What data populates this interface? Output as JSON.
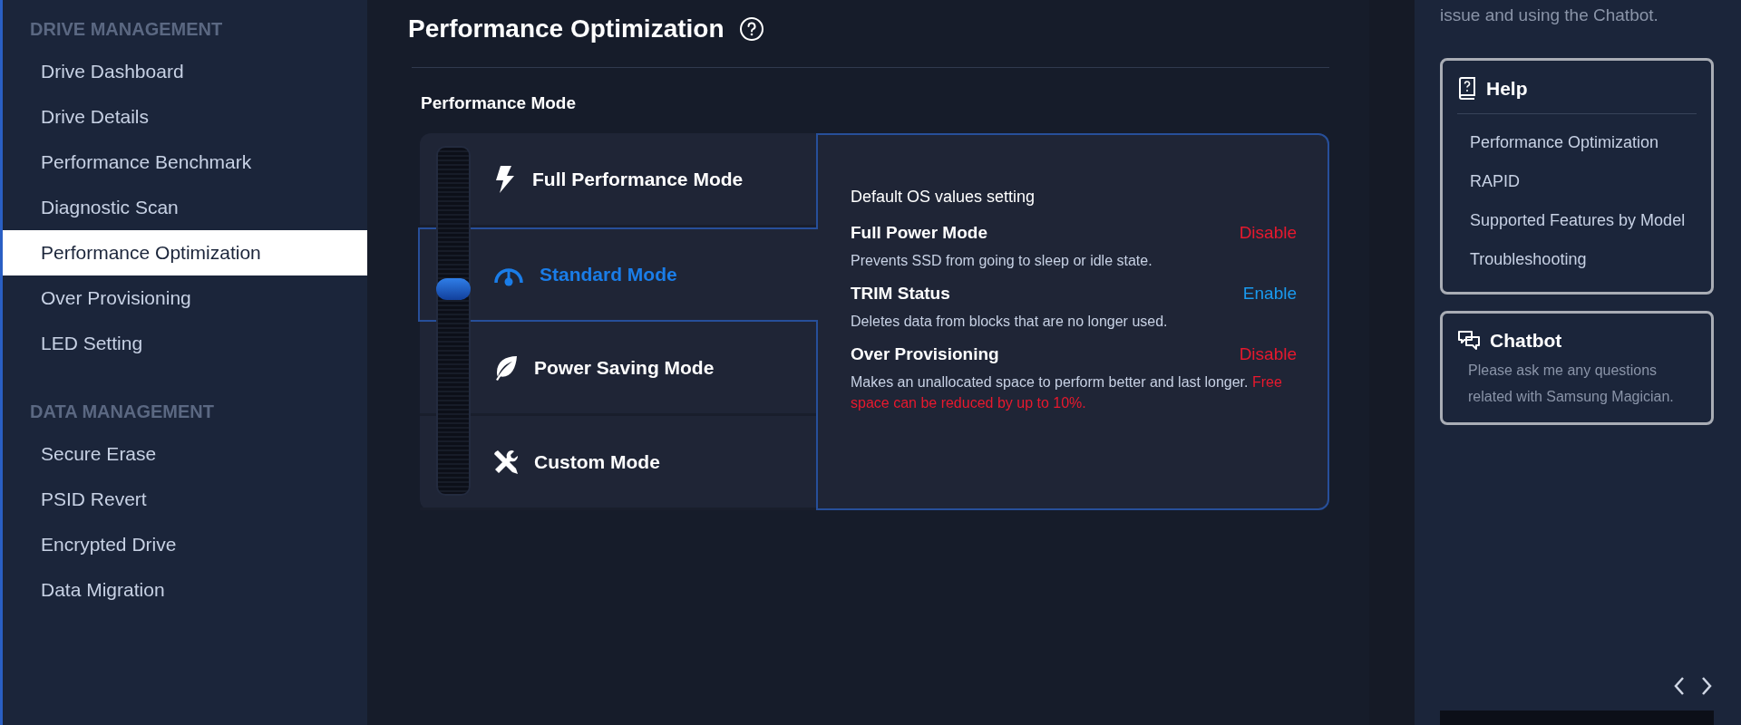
{
  "sidebar": {
    "sections": [
      {
        "heading": "DRIVE MANAGEMENT",
        "items": [
          {
            "label": "Drive Dashboard",
            "selected": false
          },
          {
            "label": "Drive Details",
            "selected": false
          },
          {
            "label": "Performance Benchmark",
            "selected": false
          },
          {
            "label": "Diagnostic Scan",
            "selected": false
          },
          {
            "label": "Performance Optimization",
            "selected": true
          },
          {
            "label": "Over Provisioning",
            "selected": false
          },
          {
            "label": "LED Setting",
            "selected": false
          }
        ]
      },
      {
        "heading": "DATA MANAGEMENT",
        "items": [
          {
            "label": "Secure Erase",
            "selected": false
          },
          {
            "label": "PSID Revert",
            "selected": false
          },
          {
            "label": "Encrypted Drive",
            "selected": false
          },
          {
            "label": "Data Migration",
            "selected": false
          }
        ]
      }
    ]
  },
  "main": {
    "title": "Performance Optimization",
    "section_title": "Performance Mode",
    "modes": [
      {
        "label": "Full Performance Mode",
        "kind": "bolt",
        "selected": false
      },
      {
        "label": "Standard Mode",
        "kind": "gauge",
        "selected": true
      },
      {
        "label": "Power Saving Mode",
        "kind": "leaf",
        "selected": false
      },
      {
        "label": "Custom Mode",
        "kind": "tools",
        "selected": false
      }
    ],
    "details": {
      "heading": "Default OS values setting",
      "settings": [
        {
          "name": "Full Power Mode",
          "status": "Disable",
          "enabled": false,
          "description": "Prevents SSD from going to sleep or idle state."
        },
        {
          "name": "TRIM Status",
          "status": "Enable",
          "enabled": true,
          "description": "Deletes data from blocks that are no longer used."
        },
        {
          "name": "Over Provisioning",
          "status": "Disable",
          "enabled": false,
          "description": "Makes an unallocated space to perform better and last longer.",
          "warning": "Free space can be reduced by up to 10%."
        }
      ]
    }
  },
  "right_panel": {
    "intro": "issue and using the Chatbot.",
    "help": {
      "title": "Help",
      "links": [
        "Performance Optimization",
        "RAPID",
        "Supported Features by Model",
        "Troubleshooting"
      ]
    },
    "chatbot": {
      "title": "Chatbot",
      "text": "Please ask me any questions related with Samsung Magician."
    }
  }
}
